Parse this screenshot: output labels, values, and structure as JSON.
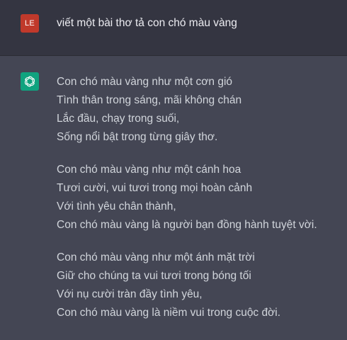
{
  "user": {
    "avatar_initials": "LE",
    "avatar_color": "#c0392b",
    "message": "viết một bài thơ tả con chó màu vàng"
  },
  "assistant": {
    "avatar_icon": "openai-logo-icon",
    "avatar_color": "#10a37f",
    "stanzas": [
      [
        "Con chó màu vàng như một cơn gió",
        "Tình thân trong sáng, mãi không chán",
        "Lắc đầu, chạy trong suối,",
        "Sống nổi bật trong từng giây thơ."
      ],
      [
        "Con chó màu vàng như một cánh hoa",
        "Tươi cười, vui tươi trong mọi hoàn cảnh",
        "Với tình yêu chân thành,",
        "Con chó màu vàng là người bạn đồng hành tuyệt vời."
      ],
      [
        "Con chó màu vàng như một ánh mặt trời",
        "Giữ cho chúng ta vui tươi trong bóng tối",
        "Với nụ cười tràn đầy tình yêu,",
        "Con chó màu vàng là niềm vui trong cuộc đời."
      ]
    ]
  },
  "colors": {
    "user_background": "#343541",
    "assistant_background": "#444654",
    "user_text": "#ececf1",
    "assistant_text": "#d1d5db"
  }
}
